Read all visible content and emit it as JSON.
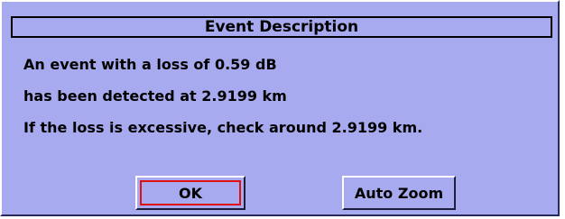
{
  "dialog": {
    "title": "Event Description",
    "message_lines": [
      "An event with a loss of 0.59 dB",
      "has been detected at 2.9199 km",
      "If the loss is excessive, check around 2.9199 km."
    ]
  },
  "buttons": {
    "ok_label": "OK",
    "auto_zoom_label": "Auto Zoom"
  },
  "colors": {
    "dialog_background": "#a8aaf0",
    "focus_ring": "#e01010"
  }
}
